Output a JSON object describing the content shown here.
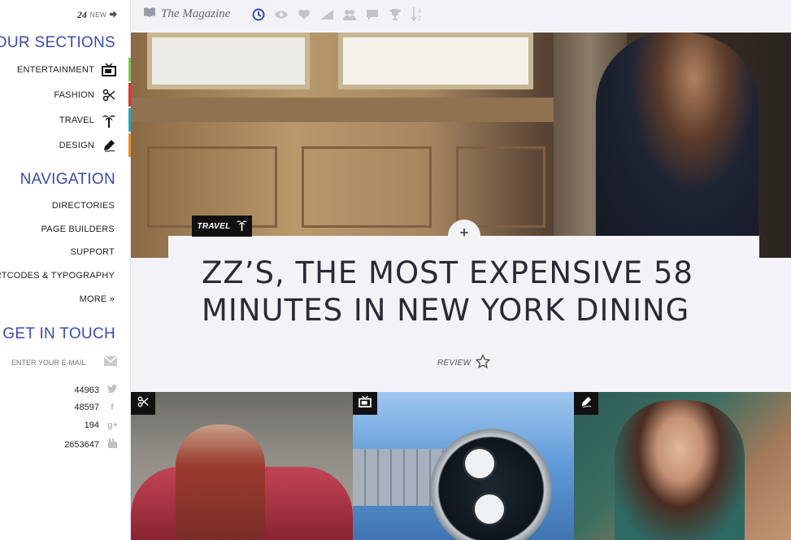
{
  "sidebar": {
    "new_count": "24",
    "new_label": "NEW",
    "sections_title": "OUR SECTIONS",
    "sections": [
      {
        "label": "ENTERTAINMENT",
        "icon": "tv-icon",
        "color": "#7fc35a"
      },
      {
        "label": "FASHION",
        "icon": "scissors-icon",
        "color": "#d9342b"
      },
      {
        "label": "TRAVEL",
        "icon": "palm-tree-icon",
        "color": "#2aa7b8"
      },
      {
        "label": "DESIGN",
        "icon": "pen-icon",
        "color": "#e8902a"
      }
    ],
    "navigation_title": "NAVIGATION",
    "navigation": [
      {
        "label": "DIRECTORIES"
      },
      {
        "label": "PAGE BUILDERS"
      },
      {
        "label": "SUPPORT"
      },
      {
        "label": "SHORTCODES & TYPOGRAPHY"
      },
      {
        "label": "MORE »"
      }
    ],
    "contact_title": "GET IN TOUCH",
    "email_placeholder": "ENTER YOUR E-MAIL",
    "social": [
      {
        "count": "44963",
        "icon": "twitter-icon"
      },
      {
        "count": "48597",
        "icon": "facebook-icon"
      },
      {
        "count": "194",
        "icon": "google-plus-icon"
      },
      {
        "count": "2653647",
        "icon": "youtube-icon"
      }
    ]
  },
  "topbar": {
    "title": "The Magazine",
    "sort_icons": [
      "clock-icon",
      "eye-icon",
      "heart-icon",
      "trending-icon",
      "users-icon",
      "comment-icon",
      "trophy-icon",
      "sort-az-icon"
    ]
  },
  "hero": {
    "category": "TRAVEL",
    "headline": "ZZ’S, THE MOST EXPENSIVE 58 MINUTES IN NEW YORK DINING",
    "review_label": "REVIEW"
  },
  "colors": {
    "accent": "#3a4bb0",
    "topbar_bg": "#f3f3f7"
  }
}
